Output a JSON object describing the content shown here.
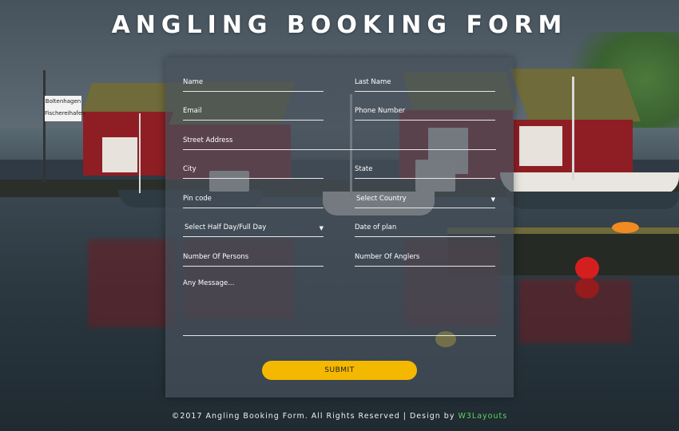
{
  "title": "ANGLING BOOKING FORM",
  "scene": {
    "sign_line1": "Boltenhagen",
    "sign_line2": "Fischereihafen"
  },
  "form": {
    "name": "Name",
    "last_name": "Last Name",
    "email": "Email",
    "phone": "Phone Number",
    "street": "Street Address",
    "city": "City",
    "state": "State",
    "pin": "Pin code",
    "country": "Select Country",
    "day_type": "Select Half Day/Full Day",
    "date": "Date of plan",
    "persons": "Number Of Persons",
    "anglers": "Number Of Anglers",
    "message": "Any Message...",
    "submit": "SUBMIT"
  },
  "footer": {
    "text": "©2017 Angling Booking Form. All Rights Reserved | Design by ",
    "brand": "W3Layouts"
  },
  "colors": {
    "submit_bg": "#f5b800",
    "brand": "#5fd35f",
    "house_red": "#8e1e24"
  }
}
